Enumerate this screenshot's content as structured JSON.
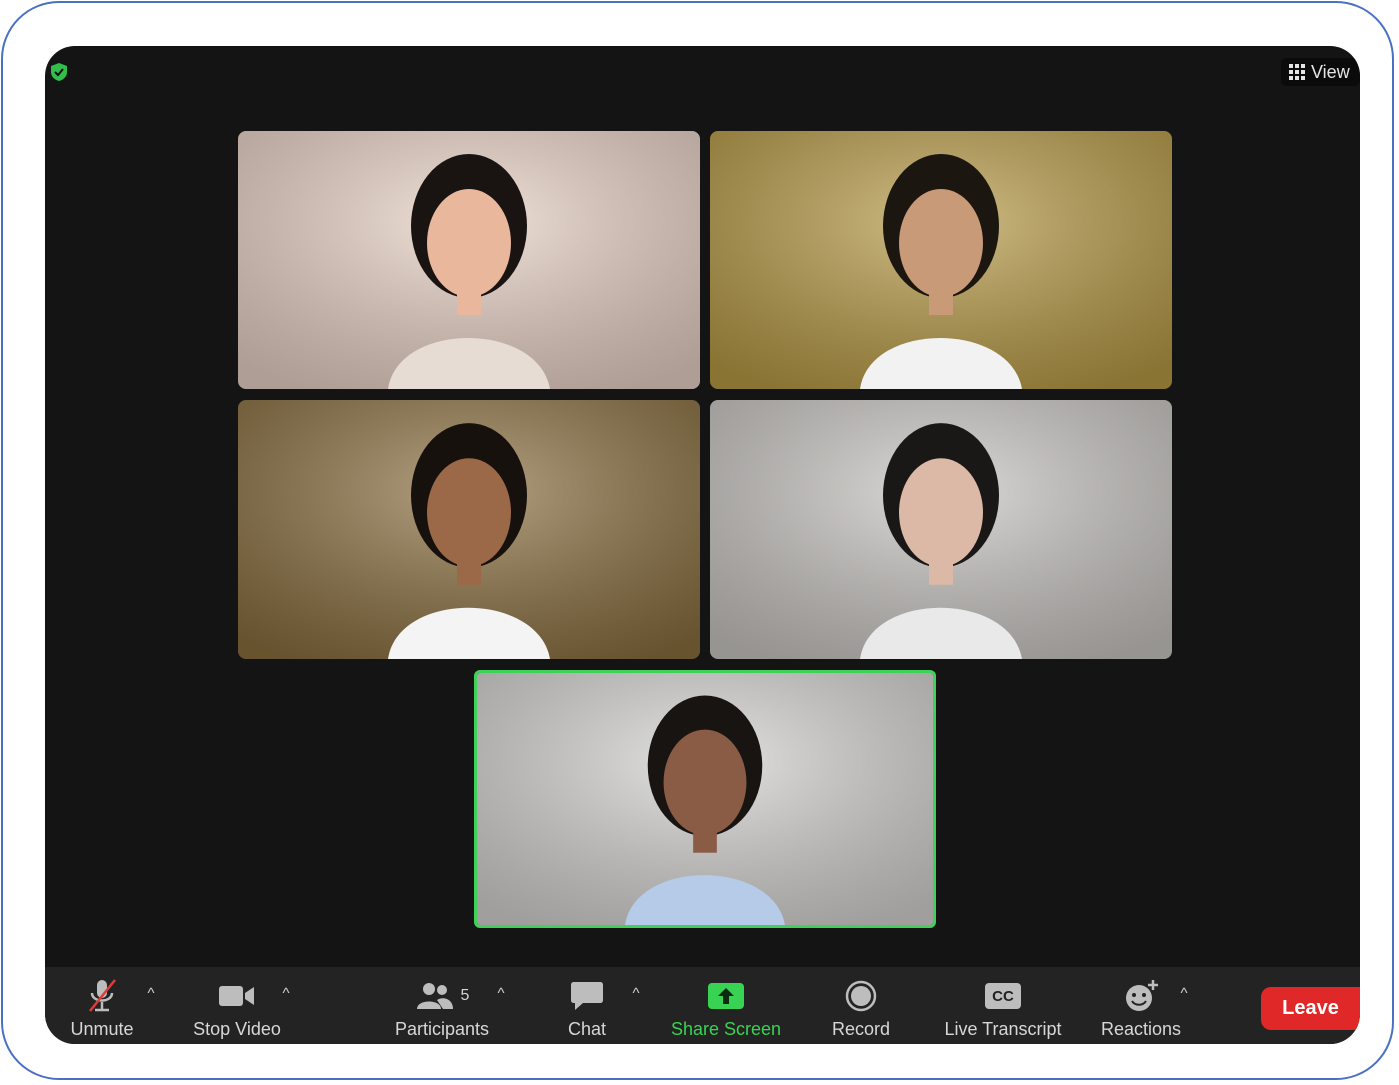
{
  "window": {
    "view_label": "View"
  },
  "tiles": [
    {
      "name": "participant-1",
      "bg": "#e9d2c6",
      "shirt": "#e6dcd3",
      "hair": "#191312",
      "skin": "#e8b79c"
    },
    {
      "name": "participant-2",
      "bg": "#b79a45",
      "shirt": "#f2f2f2",
      "hair": "#1c1611",
      "skin": "#c99a78"
    },
    {
      "name": "participant-3",
      "bg": "#8a6f3f",
      "shirt": "#f4f4f4",
      "hair": "#17110d",
      "skin": "#9b6848"
    },
    {
      "name": "participant-4",
      "bg": "#c9c6c2",
      "shirt": "#e9e9e9",
      "hair": "#1a1816",
      "skin": "#dcb9a6"
    },
    {
      "name": "participant-5-active-speaker",
      "bg": "#d5d4d1",
      "shirt": "#b6cbe8",
      "hair": "#181412",
      "skin": "#8a5b45"
    }
  ],
  "toolbar": {
    "unmute_label": "Unmute",
    "stop_video_label": "Stop Video",
    "participants_label": "Participants",
    "participants_count": "5",
    "chat_label": "Chat",
    "share_screen_label": "Share Screen",
    "record_label": "Record",
    "live_transcript_label": "Live Transcript",
    "live_transcript_icon_text": "CC",
    "reactions_label": "Reactions",
    "leave_label": "Leave"
  },
  "colors": {
    "frame_border": "#4a70c4",
    "window_bg": "#141414",
    "toolbar_bg": "#232323",
    "active_speaker_border": "#3fd15a",
    "share_screen": "#39d353",
    "leave_button": "#e02828",
    "muted_slash": "#e03b3b"
  }
}
